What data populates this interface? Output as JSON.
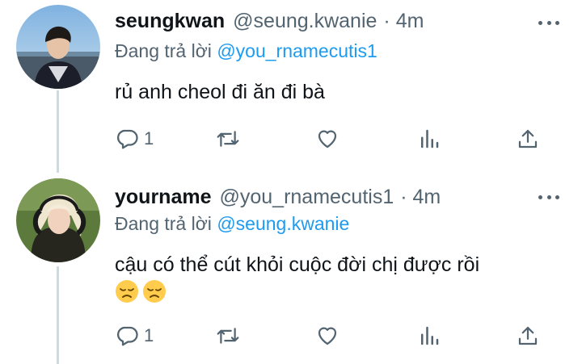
{
  "tweets": [
    {
      "name": "seungkwan",
      "handle": "@seung.kwanie",
      "time": "· 4m",
      "replying_prefix": "Đang trả lời",
      "replying_to": "@you_rnamecutis1",
      "text": "rủ anh cheol đi ăn đi bà",
      "reply_count": "1",
      "icons": [
        "reply-icon",
        "retweet-icon",
        "like-icon",
        "views-icon",
        "share-icon"
      ]
    },
    {
      "name": "yourname",
      "handle": "@you_rnamecutis1",
      "time": "· 4m",
      "replying_prefix": "Đang trả lời",
      "replying_to": "@seung.kwanie",
      "text": "cậu có thể cút khỏi cuộc đời chị được rồi",
      "emojis": [
        "disappointed-face",
        "disappointed-face"
      ],
      "reply_count": "1",
      "icons": [
        "reply-icon",
        "retweet-icon",
        "like-icon",
        "views-icon",
        "share-icon"
      ]
    }
  ],
  "colors": {
    "link": "#1d9bf0",
    "secondary": "#536471",
    "thread_line": "#cfd9de"
  }
}
